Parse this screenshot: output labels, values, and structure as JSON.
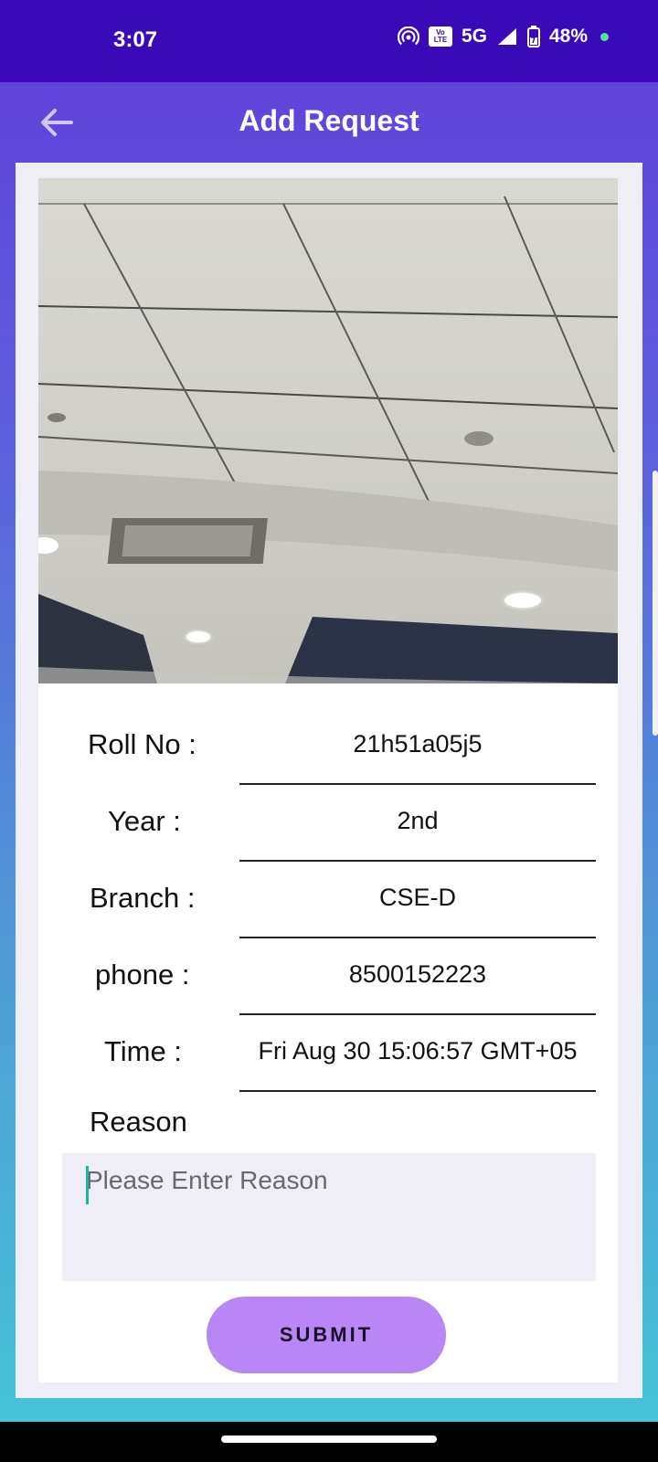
{
  "status_bar": {
    "time": "3:07",
    "network": "5G",
    "volte_top": "Vo",
    "volte_bottom": "LTE",
    "battery": "48%"
  },
  "app_bar": {
    "title": "Add Request"
  },
  "form": {
    "roll_label": "Roll No :",
    "roll_value": "21h51a05j5",
    "year_label": "Year :",
    "year_value": "2nd",
    "branch_label": "Branch :",
    "branch_value": "CSE-D",
    "phone_label": "phone :",
    "phone_value": "8500152223",
    "time_label": "Time :",
    "time_value": "Fri Aug 30 15:06:57 GMT+05",
    "reason_label": "Reason",
    "reason_placeholder": "Please Enter Reason",
    "submit_label": "SUBMIT"
  },
  "colors": {
    "status_bar": "#3b0ab8",
    "gradient_top": "#6143db",
    "gradient_bottom": "#46c3d6",
    "submit_button": "#b987f5",
    "caret": "#1ab3a6"
  }
}
